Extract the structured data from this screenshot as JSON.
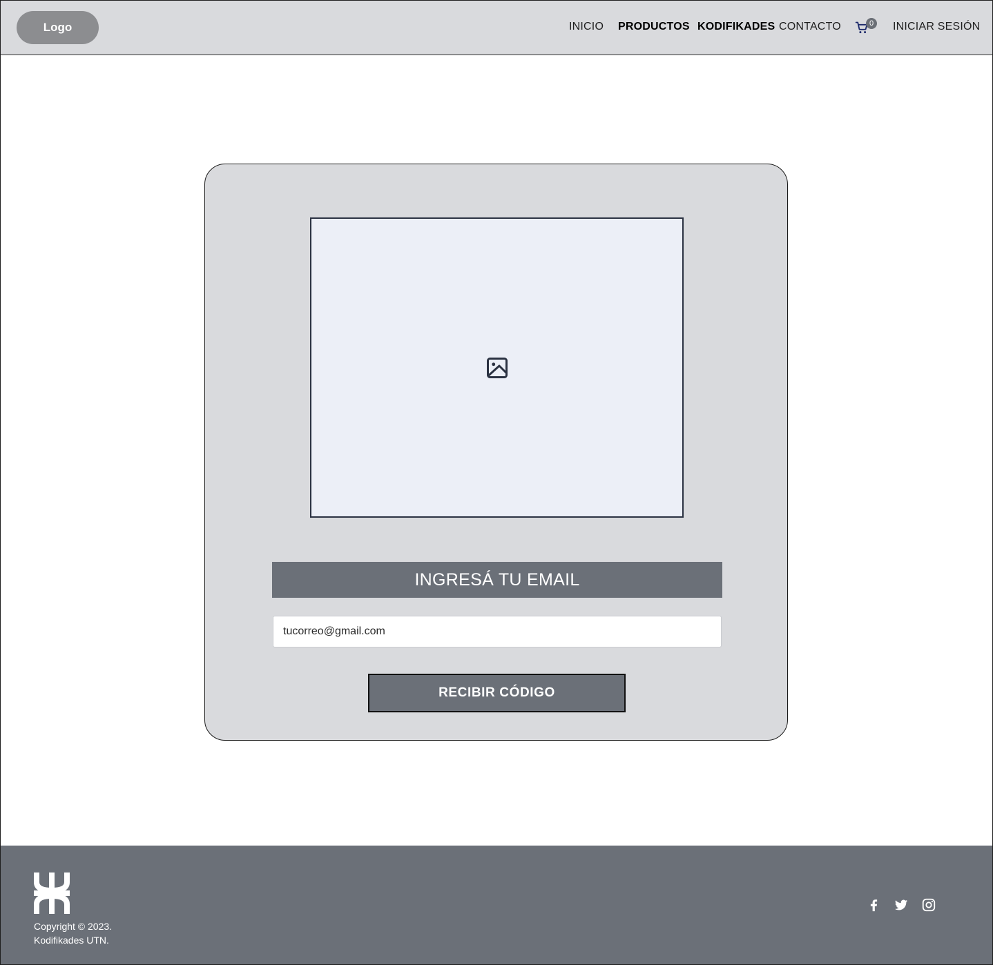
{
  "header": {
    "logo_label": "Logo",
    "nav": {
      "inicio": "INICIO",
      "productos": "PRODUCTOS",
      "kodifikades": "KODIFIKADES",
      "contacto": "CONTACTO"
    },
    "cart_icon": "shopping-cart-icon",
    "cart_count": "0",
    "login_label": "INICIAR SESIÓN"
  },
  "card": {
    "image_icon": "image-placeholder-icon",
    "title": "INGRESÁ TU EMAIL",
    "email_value": "tucorreo@gmail.com",
    "submit_label": "RECIBIR CÓDIGO"
  },
  "footer": {
    "logo_icon": "utn-logo-icon",
    "copyright_line1": "Copyright © 2023.",
    "copyright_line2": "Kodifikades UTN.",
    "social": [
      "facebook-icon",
      "twitter-icon",
      "instagram-icon"
    ]
  },
  "colors": {
    "header_bg": "#d9dadd",
    "card_bg": "#d9dadd",
    "accent_gray": "#6b7078",
    "placeholder_bg": "#eceff7",
    "cart_color": "#1d2a6b"
  }
}
